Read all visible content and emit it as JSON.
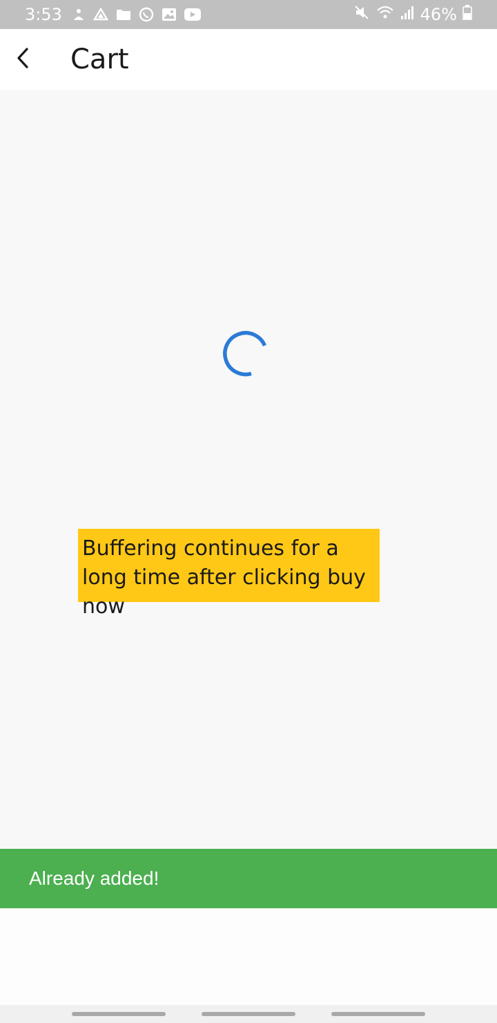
{
  "status_bar": {
    "time": "3:53",
    "battery": "46%",
    "icons": [
      "notification-icon",
      "drive-icon",
      "folder-icon",
      "whatsapp-icon",
      "gallery-icon",
      "youtube-icon"
    ],
    "right_icons": [
      "mute-icon",
      "wifi-icon",
      "signal-icon",
      "battery-icon"
    ]
  },
  "app_bar": {
    "title": "Cart"
  },
  "annotation": {
    "text": "Buffering continues for a long time after clicking buy now"
  },
  "snackbar": {
    "message": "Already added!"
  },
  "colors": {
    "status_bar_bg": "#c0c0c0",
    "spinner": "#2b7bd6",
    "annotation_bg": "#ffc816",
    "snackbar_bg": "#4caf50"
  }
}
